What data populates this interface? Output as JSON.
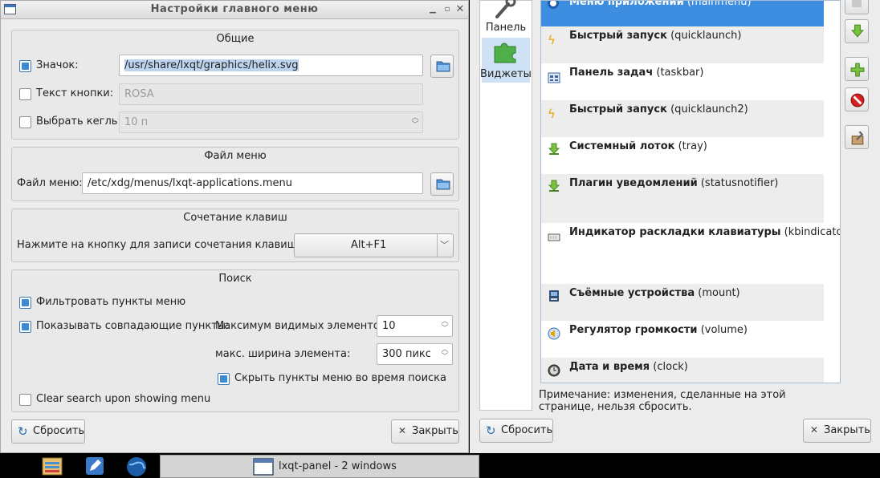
{
  "dialog": {
    "title": "Настройки главного меню",
    "groups": {
      "general": {
        "title": "Общие",
        "icon_label": "Значок:",
        "icon_path": "/usr/share/lxqt/graphics/helix.svg",
        "button_text_label": "Текст кнопки:",
        "button_text_value": "ROSA",
        "font_size_label": "Выбрать кегль:",
        "font_size_value": "10 п"
      },
      "menu_file": {
        "title": "Файл меню",
        "label": "Файл меню:",
        "value": "/etc/xdg/menus/lxqt-applications.menu"
      },
      "shortcut": {
        "title": "Сочетание клавиш",
        "label": "Нажмите на кнопку для записи сочетания клавиш:",
        "value": "Alt+F1"
      },
      "search": {
        "title": "Поиск",
        "filter_label": "Фильтровать пункты меню",
        "show_matches_label": "Показывать совпадающие пункты:",
        "max_visible_label": "Максимум видимых элементов:",
        "max_visible_value": "10",
        "max_width_label": "макс. ширина элемента:",
        "max_width_value": "300 пикс",
        "hide_label": "Скрыть пункты меню во время поиска",
        "clear_label": "Clear search upon showing menu"
      }
    },
    "reset_label": "Сбросить",
    "close_label": "Закрыть"
  },
  "panel": {
    "sidebar": [
      {
        "label": "Панель"
      },
      {
        "label": "Виджеты"
      }
    ],
    "widgets": [
      {
        "name": "Меню приложений",
        "id": "(mainmenu)"
      },
      {
        "name": "Быстрый запуск",
        "id": "(quicklaunch)"
      },
      {
        "name": "Панель задач",
        "id": "(taskbar)"
      },
      {
        "name": "Быстрый запуск",
        "id": "(quicklaunch2)"
      },
      {
        "name": "Системный лоток",
        "id": "(tray)"
      },
      {
        "name": "Плагин уведомлений",
        "id": "(statusnotifier)"
      },
      {
        "name": "Индикатор раскладки клавиатуры",
        "id": "(kbindicator)"
      },
      {
        "name": "Съёмные устройства",
        "id": "(mount)"
      },
      {
        "name": "Регулятор громкости",
        "id": "(volume)"
      },
      {
        "name": "Дата и время",
        "id": "(clock)"
      }
    ],
    "note": "Примечание: изменения, сделанные на этой странице, нельзя сбросить.",
    "reset_label": "Сбросить",
    "close_label": "Закрыть"
  },
  "taskbar": {
    "window_label": "lxqt-panel - 2 windows"
  },
  "colors": {
    "accent": "#3d8ee0",
    "window_bg": "#ececec"
  }
}
